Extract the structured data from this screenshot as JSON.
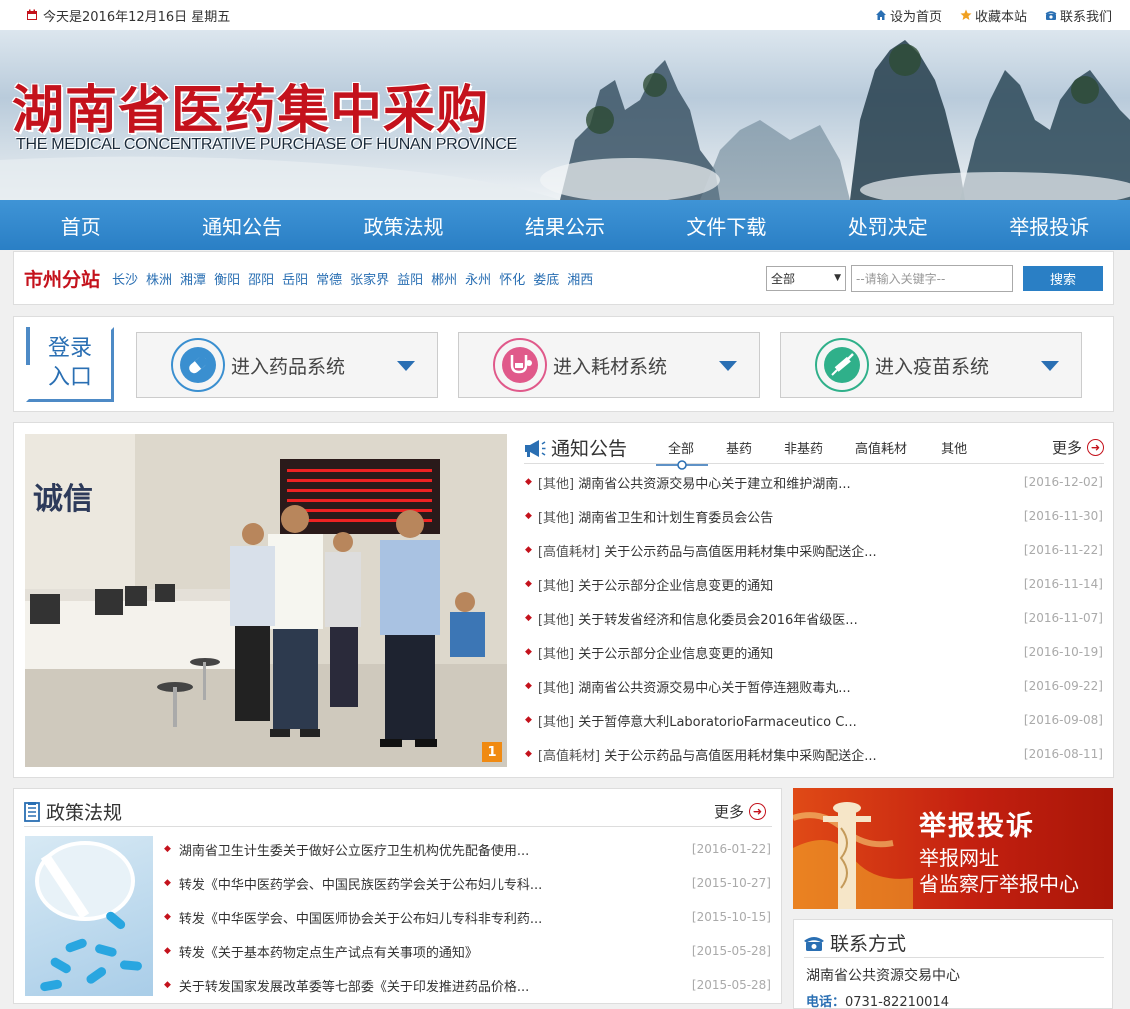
{
  "topbar": {
    "date_text": "今天是2016年12月16日 星期五",
    "set_home": "设为首页",
    "bookmark": "收藏本站",
    "contact_us": "联系我们"
  },
  "banner": {
    "title_cn": "湖南省医药集中采购",
    "title_en": "THE MEDICAL CONCENTRATIVE PURCHASE OF HUNAN PROVINCE"
  },
  "nav": [
    "首页",
    "通知公告",
    "政策法规",
    "结果公示",
    "文件下载",
    "处罚决定",
    "举报投诉"
  ],
  "citybar": {
    "title": "市州分站",
    "cities": [
      "长沙",
      "株洲",
      "湘潭",
      "衡阳",
      "邵阳",
      "岳阳",
      "常德",
      "张家界",
      "益阳",
      "郴州",
      "永州",
      "怀化",
      "娄底",
      "湘西"
    ],
    "select_value": "全部",
    "search_placeholder": "--请输入关键字--",
    "search_button": "搜索"
  },
  "login": {
    "entry_line1": "登录",
    "entry_line2": "入口",
    "systems": [
      {
        "label": "进入药品系统",
        "color": "#3a8fd0"
      },
      {
        "label": "进入耗材系统",
        "color": "#e0598a"
      },
      {
        "label": "进入疫苗系统",
        "color": "#2fb08a"
      }
    ]
  },
  "notice": {
    "title": "通知公告",
    "tabs": [
      "全部",
      "基药",
      "非基药",
      "高值耗材",
      "其他"
    ],
    "more": "更多",
    "carousel_page": "1",
    "items": [
      {
        "cat": "[其他]",
        "text": "湖南省公共资源交易中心关于建立和维护湖南...",
        "date": "[2016-12-02]"
      },
      {
        "cat": "[其他]",
        "text": "湖南省卫生和计划生育委员会公告",
        "date": "[2016-11-30]"
      },
      {
        "cat": "[高值耗材]",
        "text": "关于公示药品与高值医用耗材集中采购配送企...",
        "date": "[2016-11-22]"
      },
      {
        "cat": "[其他]",
        "text": "关于公示部分企业信息变更的通知",
        "date": "[2016-11-14]"
      },
      {
        "cat": "[其他]",
        "text": "关于转发省经济和信息化委员会2016年省级医...",
        "date": "[2016-11-07]"
      },
      {
        "cat": "[其他]",
        "text": "关于公示部分企业信息变更的通知",
        "date": "[2016-10-19]"
      },
      {
        "cat": "[其他]",
        "text": "湖南省公共资源交易中心关于暂停连翘败毒丸...",
        "date": "[2016-09-22]"
      },
      {
        "cat": "[其他]",
        "text": "关于暂停意大利LaboratorioFarmaceutico C...",
        "date": "[2016-09-08]"
      },
      {
        "cat": "[高值耗材]",
        "text": "关于公示药品与高值医用耗材集中采购配送企...",
        "date": "[2016-08-11]"
      }
    ]
  },
  "photo_sign": "诚信",
  "policy": {
    "title": "政策法规",
    "more": "更多",
    "items": [
      {
        "text": "湖南省卫生计生委关于做好公立医疗卫生机构优先配备使用...",
        "date": "[2016-01-22]"
      },
      {
        "text": "转发《中华中医药学会、中国民族医药学会关于公布妇儿专科...",
        "date": "[2015-10-27]"
      },
      {
        "text": "转发《中华医学会、中国医师协会关于公布妇儿专科非专利药...",
        "date": "[2015-10-15]"
      },
      {
        "text": "转发《关于基本药物定点生产试点有关事项的通知》",
        "date": "[2015-05-28]"
      },
      {
        "text": "关于转发国家发展改革委等七部委《关于印发推进药品价格...",
        "date": "[2015-05-28]"
      }
    ]
  },
  "report": {
    "title": "举报投诉",
    "line1": "举报网址",
    "line2": "省监察厅举报中心"
  },
  "contact": {
    "title": "联系方式",
    "org": "湖南省公共资源交易中心",
    "tel_label": "电话：",
    "tel": "0731-82210014"
  }
}
